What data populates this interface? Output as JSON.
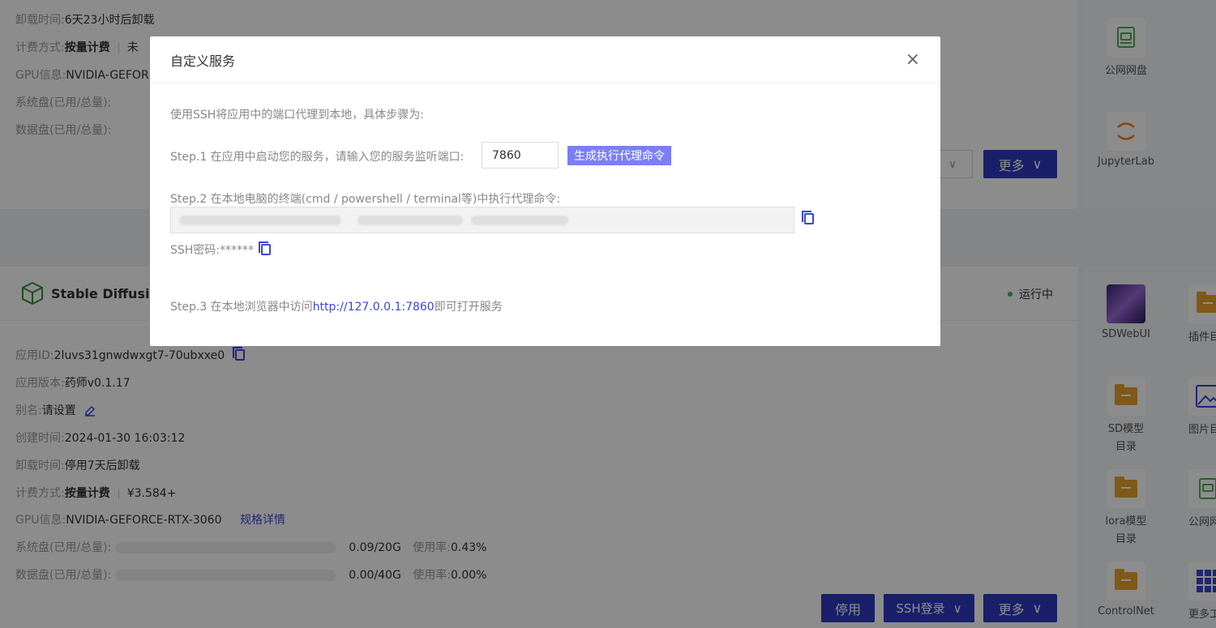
{
  "top_card": {
    "unload_key": "卸载时间:",
    "unload_val": "6天23小时后卸载",
    "billing_key": "计费方式:",
    "billing_val": "按量计费",
    "billing_extra": "未",
    "gpu_key": "GPU信息:",
    "gpu_val": "NVIDIA-GEFOR",
    "sysdisk_key": "系统盘(已用/总量):",
    "datadisk_key": "数据盘(已用/总量):",
    "more_label": "更多"
  },
  "top_panel": {
    "tiles": [
      {
        "label": "公网网盘",
        "icon": "disk-icon"
      },
      {
        "label": "JupyterLab",
        "icon": "jupyter-icon"
      }
    ]
  },
  "bottom_card": {
    "title": "Stable Diffusion",
    "status": "运行中",
    "app_id_key": "应用ID:",
    "app_id_val": "2luvs31gnwdwxgt7-70ubxxe0",
    "version_key": "应用版本:",
    "version_val": "药师v0.1.17",
    "alias_key": "别名:",
    "alias_val": "请设置",
    "created_key": "创建时间:",
    "created_val": "2024-01-30 16:03:12",
    "unload_key": "卸载时间:",
    "unload_val": "停用7天后卸载",
    "billing_key": "计费方式:",
    "billing_val": "按量计费",
    "billing_price": "¥3.584+",
    "gpu_key": "GPU信息:",
    "gpu_val": "NVIDIA-GEFORCE-RTX-3060",
    "gpu_link": "规格详情",
    "sysdisk_key": "系统盘(已用/总量):",
    "sysdisk_usage": "0.09/20G",
    "sysdisk_rate_key": "使用率:",
    "sysdisk_rate": "0.43%",
    "datadisk_key": "数据盘(已用/总量):",
    "datadisk_usage": "0.00/40G",
    "datadisk_rate_key": "使用率:",
    "datadisk_rate": "0.00%",
    "stop_label": "停用",
    "ssh_label": "SSH登录",
    "more_label": "更多"
  },
  "bottom_panel": {
    "tiles": [
      {
        "label": "SDWebUI"
      },
      {
        "label": "插件目"
      },
      {
        "label": "SD模型目录"
      },
      {
        "label": "图片目"
      },
      {
        "label": "lora模型目录"
      },
      {
        "label": "公网网"
      },
      {
        "label": "ControlNet"
      },
      {
        "label": "更多工"
      }
    ]
  },
  "modal": {
    "title": "自定义服务",
    "close": "×",
    "intro": "使用SSH将应用中的端口代理到本地，具体步骤为:",
    "step1": "Step.1 在应用中启动您的服务，请输入您的服务监听端口:",
    "port_value": "7860",
    "generate_label": "生成执行代理命令",
    "step2": "Step.2 在本地电脑的终端(cmd / powershell / terminal等)中执行代理命令:",
    "ssh_password_label": "SSH密码:",
    "ssh_password_value": "******",
    "step3_prefix": "Step.3 在本地浏览器中访问",
    "step3_link": "http://127.0.0.1:7860",
    "step3_suffix": "即可打开服务"
  },
  "colors": {
    "primary": "#2f3bbf",
    "accent_button": "#7b7ff4",
    "link": "#3a46d8",
    "status_green": "#4caf50",
    "folder": "#e8a32a"
  }
}
